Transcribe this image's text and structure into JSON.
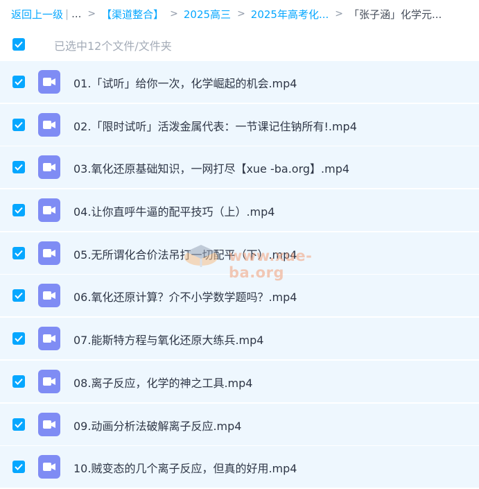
{
  "breadcrumb": {
    "back": "返回上一级",
    "separator": "|",
    "ellipsis": "...",
    "crumbs": [
      "【渠道整合】",
      "2025高三",
      "2025年高考化..."
    ],
    "current": "「张子涵」化学元..."
  },
  "selection": {
    "status": "已选中12个文件/文件夹",
    "all_checked": true
  },
  "files": [
    {
      "name": "01.「试听」给你一次，化学崛起的机会.mp4",
      "checked": true,
      "icon": "video-icon"
    },
    {
      "name": "02.「限时试听」活泼金属代表：一节课记住钠所有!.mp4",
      "checked": true,
      "icon": "video-icon"
    },
    {
      "name": "03.氧化还原基础知识，一网打尽【xue -ba.org】.mp4",
      "checked": true,
      "icon": "video-icon"
    },
    {
      "name": "04.让你直呼牛逼的配平技巧（上）.mp4",
      "checked": true,
      "icon": "video-icon"
    },
    {
      "name": "05.无所谓化合价法吊打一切配平（下）.mp4",
      "checked": true,
      "icon": "video-icon"
    },
    {
      "name": "06.氧化还原计算？介不小学数学题吗？.mp4",
      "checked": true,
      "icon": "video-icon"
    },
    {
      "name": "07.能斯特方程与氧化还原大练兵.mp4",
      "checked": true,
      "icon": "video-icon"
    },
    {
      "name": "08.离子反应，化学的神之工具.mp4",
      "checked": true,
      "icon": "video-icon"
    },
    {
      "name": "09.动画分析法破解离子反应.mp4",
      "checked": true,
      "icon": "video-icon"
    },
    {
      "name": "10.贼变态的几个离子反应，但真的好用.mp4",
      "checked": true,
      "icon": "video-icon"
    }
  ],
  "watermark": {
    "text": "www.xue-ba.org"
  },
  "colors": {
    "accent": "#06a7ff",
    "row_bg": "#eef7fe",
    "video_icon": "#7f8cf4",
    "text": "#2e3646",
    "muted": "#a3abb7"
  }
}
